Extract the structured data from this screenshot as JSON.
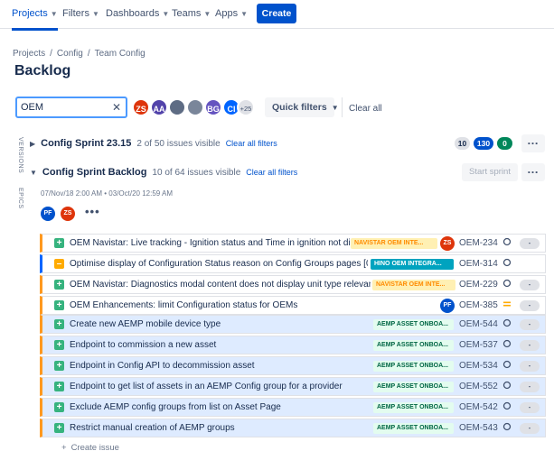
{
  "nav": {
    "items": [
      {
        "label": "Projects",
        "active": true
      },
      {
        "label": "Filters",
        "active": false
      },
      {
        "label": "Dashboards",
        "active": false
      },
      {
        "label": "Teams",
        "active": false
      },
      {
        "label": "Apps",
        "active": false
      }
    ],
    "create_label": "Create"
  },
  "breadcrumb": [
    "Projects",
    "Config",
    "Team Config"
  ],
  "page_title": "Backlog",
  "search": {
    "value": "OEM",
    "clear_icon": "close-icon"
  },
  "avatars": [
    {
      "initials": "ZS",
      "color": "#de350b"
    },
    {
      "initials": "AA",
      "color": "#5243aa"
    },
    {
      "initials": "",
      "color": "#5e6c84"
    },
    {
      "initials": "",
      "color": "#6b778c"
    },
    {
      "initials": "BG",
      "color": "#6554c0"
    },
    {
      "initials": "CI",
      "color": "#0065ff"
    },
    {
      "initials": "+25",
      "color": "#dfe1e6"
    }
  ],
  "quick_filters_label": "Quick filters",
  "clear_all_label": "Clear all",
  "side_labels": {
    "versions": "VERSIONS",
    "epics": "EPICS"
  },
  "sprints": [
    {
      "name": "Config Sprint 23.15",
      "count": "2 of 50 issues visible",
      "clear_filters": "Clear all filters",
      "badges": [
        {
          "value": "10",
          "color": "#dfe1e6",
          "text_color": "#172b4d"
        },
        {
          "value": "130",
          "color": "#0052cc",
          "text_color": "#ffffff"
        },
        {
          "value": "0",
          "color": "#00875a",
          "text_color": "#ffffff"
        }
      ],
      "collapsed": true
    },
    {
      "name": "Config Sprint Backlog",
      "count": "10 of 64 issues visible",
      "clear_filters": "Clear all filters",
      "start_sprint": "Start sprint",
      "dates": "07/Nov/18 2:00 AM • 03/Oct/20 12:59 AM",
      "members": [
        {
          "initials": "PF",
          "color": "#0052cc"
        },
        {
          "initials": "ZS",
          "color": "#de350b"
        }
      ],
      "collapsed": false
    }
  ],
  "issues": [
    {
      "type": "story",
      "summary": "OEM Navistar: Live tracking - Ignition status and Time in ignition not displayed",
      "epic": "NAVISTAR OEM INTE...",
      "epic_bg": "#fff0b3",
      "epic_fg": "#ff8b00",
      "assignee": "ZS",
      "assignee_color": "#de350b",
      "key": "OEM-234",
      "priority": "circle",
      "estimate": "-",
      "selected": false,
      "stripe": "#ff991f"
    },
    {
      "type": "task",
      "summary": "Optimise display of Configuration Status reason on Config Groups pages [0.5d]",
      "epic": "HINO OEM INTEGRA...",
      "epic_bg": "#00a3bf",
      "epic_fg": "#ffffff",
      "assignee": "",
      "assignee_color": "",
      "key": "OEM-314",
      "priority": "circle",
      "estimate": "",
      "selected": false,
      "stripe": "#0065ff"
    },
    {
      "type": "story",
      "summary": "OEM Navistar: Diagnostics modal content does not display unit type relevant data",
      "epic": "NAVISTAR OEM INTE...",
      "epic_bg": "#fff0b3",
      "epic_fg": "#ff8b00",
      "assignee": "",
      "assignee_color": "",
      "key": "OEM-229",
      "priority": "circle",
      "estimate": "-",
      "selected": false,
      "stripe": "#ff991f"
    },
    {
      "type": "story",
      "summary": "OEM Enhancements: limit Configuration status for OEMs",
      "epic": "",
      "epic_bg": "",
      "epic_fg": "",
      "assignee": "PF",
      "assignee_color": "#0052cc",
      "key": "OEM-385",
      "priority": "medium",
      "estimate": "-",
      "selected": false,
      "stripe": "#ff991f"
    },
    {
      "type": "story",
      "summary": "Create new AEMP mobile device type",
      "epic": "AEMP ASSET ONBOA...",
      "epic_bg": "#e3fcef",
      "epic_fg": "#006644",
      "assignee": "",
      "assignee_color": "",
      "key": "OEM-544",
      "priority": "circle",
      "estimate": "-",
      "selected": true,
      "stripe": "#ff991f"
    },
    {
      "type": "story",
      "summary": "Endpoint to commission a new asset",
      "epic": "AEMP ASSET ONBOA...",
      "epic_bg": "#e3fcef",
      "epic_fg": "#006644",
      "assignee": "",
      "assignee_color": "",
      "key": "OEM-537",
      "priority": "circle",
      "estimate": "-",
      "selected": true,
      "stripe": "#ff991f"
    },
    {
      "type": "story",
      "summary": "Endpoint in Config API to decommission asset",
      "epic": "AEMP ASSET ONBOA...",
      "epic_bg": "#e3fcef",
      "epic_fg": "#006644",
      "assignee": "",
      "assignee_color": "",
      "key": "OEM-534",
      "priority": "circle",
      "estimate": "-",
      "selected": true,
      "stripe": "#ff991f"
    },
    {
      "type": "story",
      "summary": "Endpoint to get list of assets in an AEMP Config group for a provider",
      "epic": "AEMP ASSET ONBOA...",
      "epic_bg": "#e3fcef",
      "epic_fg": "#006644",
      "assignee": "",
      "assignee_color": "",
      "key": "OEM-552",
      "priority": "circle",
      "estimate": "-",
      "selected": true,
      "stripe": "#ff991f"
    },
    {
      "type": "story",
      "summary": "Exclude AEMP config groups from list on Asset Page",
      "epic": "AEMP ASSET ONBOA...",
      "epic_bg": "#e3fcef",
      "epic_fg": "#006644",
      "assignee": "",
      "assignee_color": "",
      "key": "OEM-542",
      "priority": "circle",
      "estimate": "-",
      "selected": true,
      "stripe": "#ff991f"
    },
    {
      "type": "story",
      "summary": "Restrict manual creation of AEMP groups",
      "epic": "AEMP ASSET ONBOA...",
      "epic_bg": "#e3fcef",
      "epic_fg": "#006644",
      "assignee": "",
      "assignee_color": "",
      "key": "OEM-543",
      "priority": "circle",
      "estimate": "-",
      "selected": true,
      "stripe": "#ff991f"
    }
  ],
  "create_issue_label": "Create issue"
}
